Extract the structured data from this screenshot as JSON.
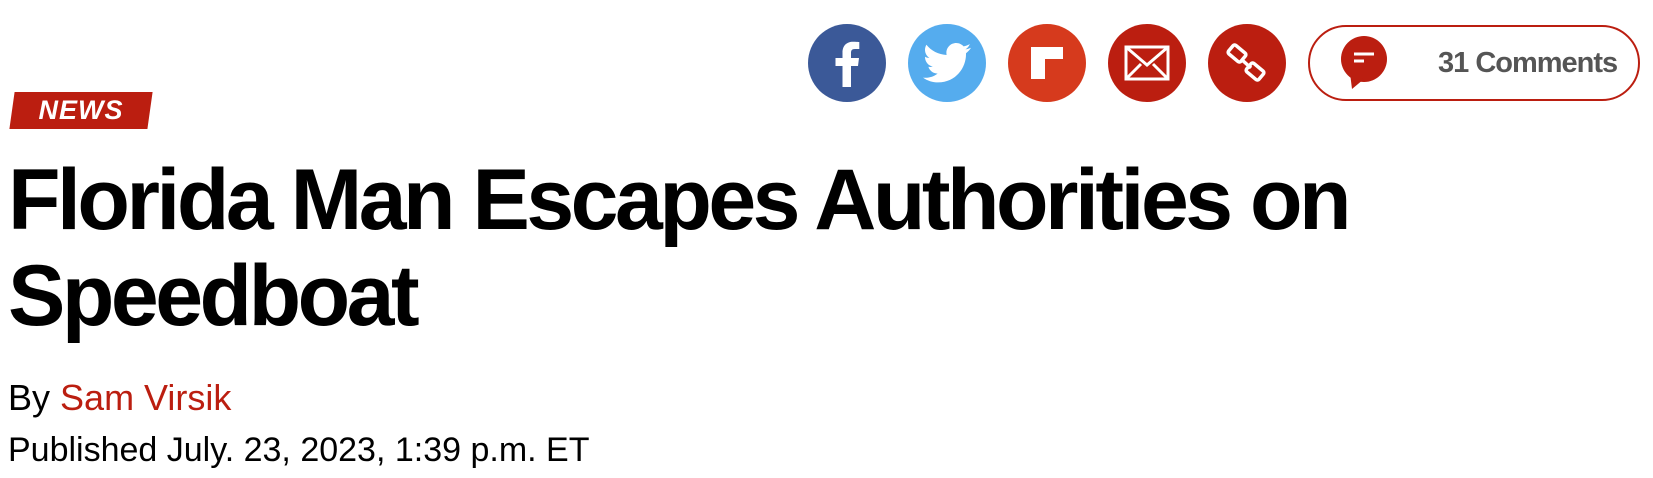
{
  "share_bar": {
    "buttons": [
      {
        "network": "Facebook",
        "icon": "facebook-icon",
        "color": "#3b5998"
      },
      {
        "network": "Twitter",
        "icon": "twitter-icon",
        "color": "#55acee"
      },
      {
        "network": "Flipboard",
        "icon": "flipboard-icon",
        "color": "#d63a1d"
      },
      {
        "network": "Email",
        "icon": "email-icon",
        "color": "#bb1e10"
      },
      {
        "network": "Copy link",
        "icon": "link-icon",
        "color": "#bb1e10"
      }
    ],
    "comments": {
      "label": "31 Comments",
      "icon": "comment-bubble-icon",
      "accent": "#bb1e10"
    }
  },
  "article": {
    "section_tag": "NEWS",
    "headline": "Florida Man Escapes Authorities on Speedboat",
    "byline_prefix": "By",
    "author": "Sam Virsik",
    "published": "Published July. 23, 2023, 1:39 p.m. ET"
  },
  "colors": {
    "accent": "#bb1e10",
    "text": "#000000"
  }
}
